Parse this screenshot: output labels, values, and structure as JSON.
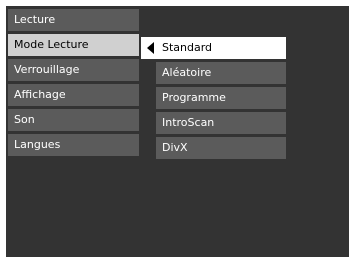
{
  "main_menu": {
    "items": [
      {
        "label": "Lecture"
      },
      {
        "label": "Mode Lecture",
        "selected": true
      },
      {
        "label": "Verrouillage"
      },
      {
        "label": "Affichage"
      },
      {
        "label": "Son"
      },
      {
        "label": "Langues"
      }
    ]
  },
  "submenu": {
    "items": [
      {
        "label": "Standard",
        "selected": true
      },
      {
        "label": "Aléatoire"
      },
      {
        "label": "Programme"
      },
      {
        "label": "IntroScan"
      },
      {
        "label": "DivX"
      }
    ],
    "selected_indicator_icon": "left-triangle-arrow"
  },
  "colors": {
    "background": "#333333",
    "item": "#5b5b5b",
    "selected_main": "#d0d0d0",
    "selected_sub": "#ffffff"
  }
}
